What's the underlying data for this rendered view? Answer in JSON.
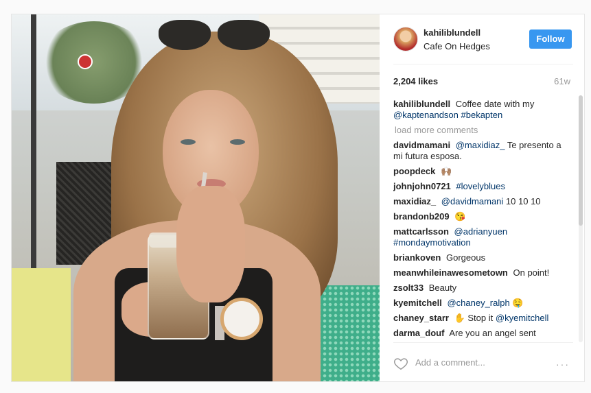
{
  "post": {
    "username": "kahiliblundell",
    "location": "Cafe On Hedges",
    "follow_label": "Follow",
    "likes": "2,204 likes",
    "time": "61w",
    "caption": {
      "user": "kahiliblundell",
      "text_before": "Coffee date with my",
      "tag1": "@kaptenandson",
      "tag2": "#bekapten"
    },
    "load_more": "load more comments",
    "comments": [
      {
        "user": "davidmamani",
        "tag": "@maxidiaz_",
        "text": "Te presento a mi futura esposa."
      },
      {
        "user": "poopdeck",
        "emoji": "🙌🏽"
      },
      {
        "user": "johnjohn0721",
        "tag": "#lovelyblues"
      },
      {
        "user": "maxidiaz_",
        "tag": "@davidmamani",
        "text": "10 10 10"
      },
      {
        "user": "brandonb209",
        "emoji": "😘"
      },
      {
        "user": "mattcarlsson",
        "tag": "@adrianyuen",
        "tag2": "#mondaymotivation"
      },
      {
        "user": "briankoven",
        "text": "Gorgeous"
      },
      {
        "user": "meanwhileinawesometown",
        "text": "On point!"
      },
      {
        "user": "zsolt33",
        "text": "Beauty"
      },
      {
        "user": "kyemitchell",
        "tag": "@chaney_ralph",
        "emoji": "🤤"
      },
      {
        "user": "chaney_starr",
        "emoji": "✋",
        "text": "Stop it",
        "tag": "@kyemitchell"
      },
      {
        "user": "darma_douf",
        "text": "Are you an angel sent"
      }
    ],
    "add_comment_placeholder": "Add a comment...",
    "more_dots": "···"
  },
  "colors": {
    "follow_bg": "#3897f0",
    "tag": "#003569",
    "muted": "#999999"
  },
  "icons": {
    "like": "heart-outline-icon",
    "more": "more-options-icon"
  }
}
